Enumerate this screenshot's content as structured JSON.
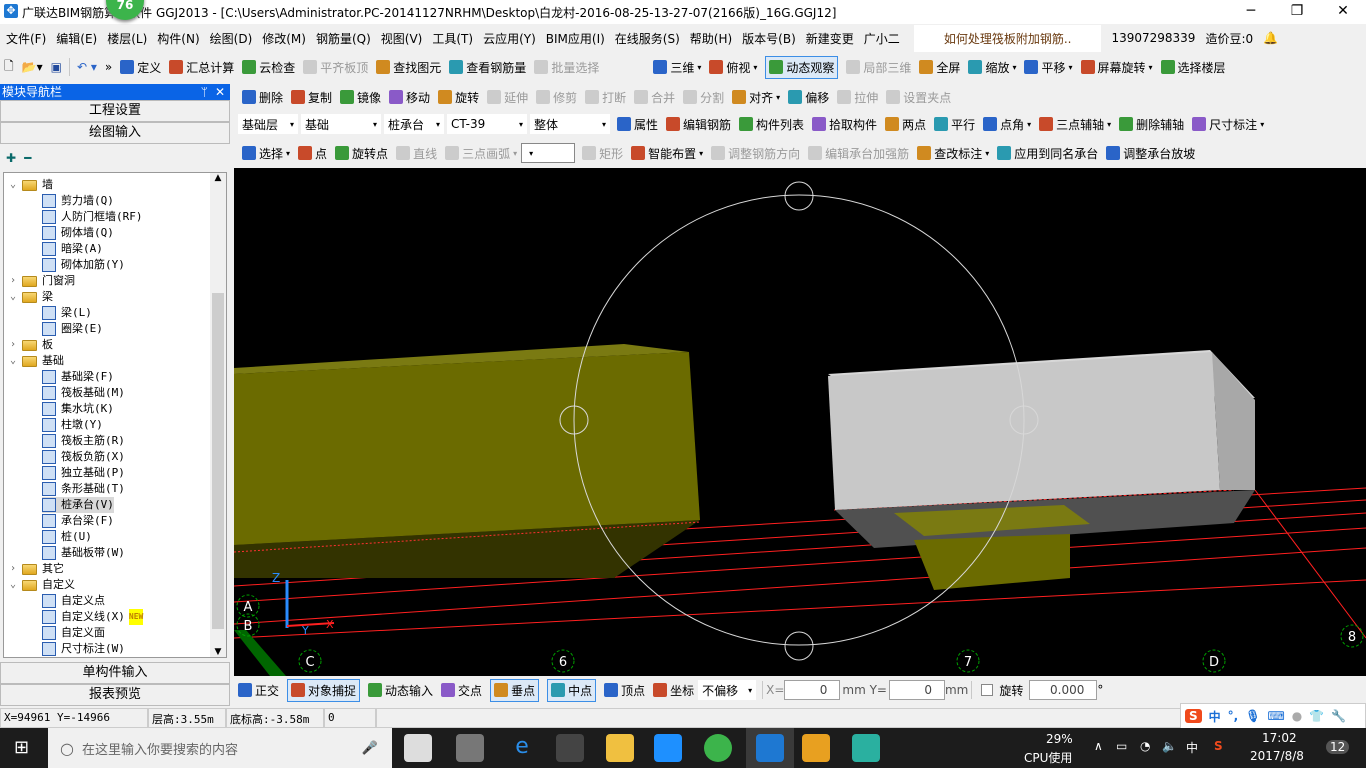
{
  "window": {
    "title": "广联达BIM钢筋算量软件 GGJ2013 - [C:\\Users\\Administrator.PC-20141127NRHM\\Desktop\\白龙村-2016-08-25-13-27-07(2166版)_16G.GGJ12]",
    "badge": "76",
    "minimize": "─",
    "maximize": "❐",
    "close": "✕"
  },
  "menu": [
    "文件(F)",
    "编辑(E)",
    "楼层(L)",
    "构件(N)",
    "绘图(D)",
    "修改(M)",
    "钢筋量(Q)",
    "视图(V)",
    "工具(T)",
    "云应用(Y)",
    "BIM应用(I)",
    "在线服务(S)",
    "帮助(H)",
    "版本号(B)"
  ],
  "menu_right": {
    "new_change": "新建变更",
    "assistant": "广小二",
    "question": "如何处理筏板附加钢筋..",
    "phone": "13907298339",
    "beans": "造价豆:0"
  },
  "toolbar1": {
    "items": [
      {
        "label": "定义",
        "disabled": false
      },
      {
        "label": "汇总计算",
        "disabled": false
      },
      {
        "label": "云检查",
        "disabled": false
      },
      {
        "label": "平齐板顶",
        "disabled": true
      },
      {
        "label": "查找图元",
        "disabled": false
      },
      {
        "label": "查看钢筋量",
        "disabled": false
      },
      {
        "label": "批量选择",
        "disabled": true
      }
    ],
    "view_items": [
      {
        "label": "三维",
        "dropdown": true
      },
      {
        "label": "俯视",
        "dropdown": true
      },
      {
        "label": "动态观察",
        "active": true
      },
      {
        "label": "局部三维",
        "disabled": true
      },
      {
        "label": "全屏"
      },
      {
        "label": "缩放",
        "dropdown": true
      },
      {
        "label": "平移",
        "dropdown": true
      },
      {
        "label": "屏幕旋转",
        "dropdown": true
      },
      {
        "label": "选择楼层"
      }
    ]
  },
  "toolbar2": [
    {
      "label": "删除"
    },
    {
      "label": "复制"
    },
    {
      "label": "镜像"
    },
    {
      "label": "移动"
    },
    {
      "label": "旋转"
    },
    {
      "label": "延伸",
      "disabled": true
    },
    {
      "label": "修剪",
      "disabled": true
    },
    {
      "label": "打断",
      "disabled": true
    },
    {
      "label": "合并",
      "disabled": true
    },
    {
      "label": "分割",
      "disabled": true
    },
    {
      "label": "对齐",
      "dropdown": true
    },
    {
      "label": "偏移"
    },
    {
      "label": "拉伸",
      "disabled": true
    },
    {
      "label": "设置夹点",
      "disabled": true
    }
  ],
  "toolbar3": {
    "selects": [
      "基础层",
      "基础",
      "桩承台",
      "CT-39",
      "整体"
    ],
    "items": [
      {
        "label": "属性"
      },
      {
        "label": "编辑钢筋"
      },
      {
        "label": "构件列表"
      },
      {
        "label": "拾取构件"
      },
      {
        "label": "两点"
      },
      {
        "label": "平行"
      },
      {
        "label": "点角",
        "dropdown": true
      },
      {
        "label": "三点辅轴",
        "dropdown": true
      },
      {
        "label": "删除辅轴"
      },
      {
        "label": "尺寸标注",
        "dropdown": true
      }
    ]
  },
  "toolbar4": {
    "items": [
      {
        "label": "选择",
        "dropdown": true
      },
      {
        "label": "点"
      },
      {
        "label": "旋转点"
      },
      {
        "label": "直线",
        "disabled": true
      },
      {
        "label": "三点画弧",
        "disabled": true,
        "dropdown": true
      },
      {
        "label": "",
        "combo": true
      },
      {
        "label": "矩形",
        "disabled": true
      },
      {
        "label": "智能布置",
        "dropdown": true
      },
      {
        "label": "调整钢筋方向",
        "disabled": true
      },
      {
        "label": "编辑承台加强筋",
        "disabled": true
      },
      {
        "label": "查改标注",
        "dropdown": true
      },
      {
        "label": "应用到同名承台"
      },
      {
        "label": "调整承台放坡"
      }
    ]
  },
  "nav": {
    "title": "模块导航栏",
    "pin": "ᛘ",
    "close": "✕",
    "project_settings": "工程设置",
    "drawing_input": "绘图输入",
    "single_input": "单构件输入",
    "report_preview": "报表预览",
    "tree": [
      {
        "label": "墙",
        "level": 0,
        "expanded": true
      },
      {
        "label": "剪力墙(Q)",
        "level": 1
      },
      {
        "label": "人防门框墙(RF)",
        "level": 1
      },
      {
        "label": "砌体墙(Q)",
        "level": 1
      },
      {
        "label": "暗梁(A)",
        "level": 1
      },
      {
        "label": "砌体加筋(Y)",
        "level": 1
      },
      {
        "label": "门窗洞",
        "level": 0,
        "expanded": false
      },
      {
        "label": "梁",
        "level": 0,
        "expanded": true
      },
      {
        "label": "梁(L)",
        "level": 1
      },
      {
        "label": "圈梁(E)",
        "level": 1
      },
      {
        "label": "板",
        "level": 0,
        "expanded": false
      },
      {
        "label": "基础",
        "level": 0,
        "expanded": true
      },
      {
        "label": "基础梁(F)",
        "level": 1
      },
      {
        "label": "筏板基础(M)",
        "level": 1
      },
      {
        "label": "集水坑(K)",
        "level": 1
      },
      {
        "label": "柱墩(Y)",
        "level": 1
      },
      {
        "label": "筏板主筋(R)",
        "level": 1
      },
      {
        "label": "筏板负筋(X)",
        "level": 1
      },
      {
        "label": "独立基础(P)",
        "level": 1
      },
      {
        "label": "条形基础(T)",
        "level": 1
      },
      {
        "label": "桩承台(V)",
        "level": 1,
        "selected": true
      },
      {
        "label": "承台梁(F)",
        "level": 1
      },
      {
        "label": "桩(U)",
        "level": 1
      },
      {
        "label": "基础板带(W)",
        "level": 1
      },
      {
        "label": "其它",
        "level": 0,
        "expanded": false
      },
      {
        "label": "自定义",
        "level": 0,
        "expanded": true
      },
      {
        "label": "自定义点",
        "level": 1
      },
      {
        "label": "自定义线(X)",
        "level": 1,
        "new": "NEW"
      },
      {
        "label": "自定义面",
        "level": 1
      },
      {
        "label": "尺寸标注(W)",
        "level": 1
      }
    ]
  },
  "viewport": {
    "axis_labels": [
      "A",
      "B",
      "C",
      "6",
      "7",
      "D",
      "8"
    ],
    "gizmo": {
      "z": "Z",
      "y": "Y",
      "x": "X"
    },
    "colors": {
      "background": "#000000",
      "yellow_cap": "#6b6b00",
      "grey_cap": "#c8c8c8",
      "grid": "#ff2020",
      "axis_circle": "#00a000"
    }
  },
  "snapbar": {
    "items": [
      {
        "label": "正交"
      },
      {
        "label": "对象捕捉",
        "active": true
      },
      {
        "label": "动态输入"
      },
      {
        "label": "交点"
      },
      {
        "label": "垂点",
        "active": true
      },
      {
        "label": "中点",
        "active": true
      },
      {
        "label": "顶点"
      },
      {
        "label": "坐标"
      }
    ],
    "offset": "不偏移",
    "x_label": "X=",
    "x_value": "0",
    "y_label": "mm Y=",
    "y_value": "0",
    "unit": "mm",
    "rotate_label": "旋转",
    "rotate_value": "0.000",
    "deg": "°"
  },
  "status": {
    "coords": "X=94961 Y=-14966",
    "floor_height": "层高:3.55m",
    "bottom_elev": "底标高:-3.58m",
    "value": "0"
  },
  "taskbar": {
    "search_placeholder": "在这里输入你要搜索的内容",
    "cpu": "29%",
    "cpu_label": "CPU使用",
    "ime": "中",
    "time": "17:02",
    "date": "2017/8/8",
    "notifications": "12"
  },
  "ime_bar": {
    "logo": "S",
    "mode": "中",
    "punct": "°,"
  }
}
